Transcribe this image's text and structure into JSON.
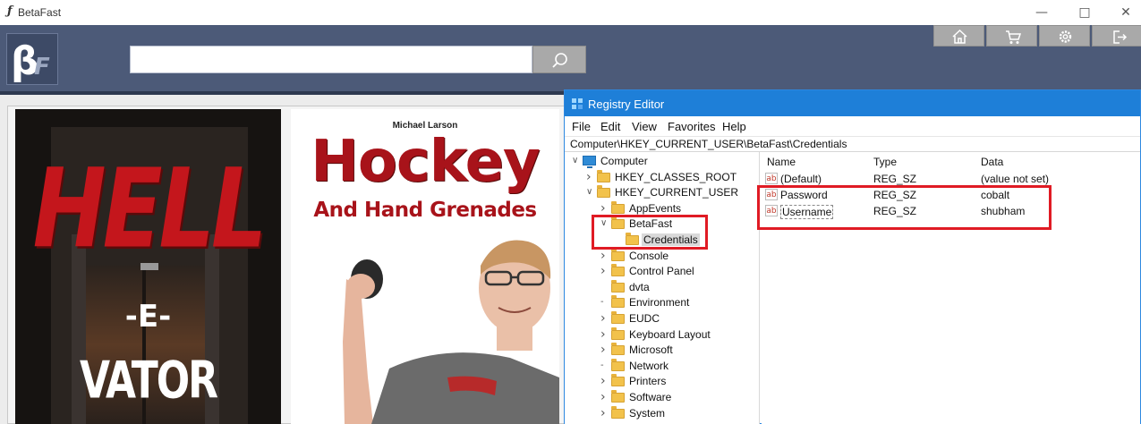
{
  "betafast": {
    "title": "BetaFast",
    "search_placeholder": "",
    "icons": [
      "search-icon",
      "home-icon",
      "cart-icon",
      "gear-icon",
      "logout-icon"
    ],
    "covers": [
      {
        "title_big": "HELL",
        "mid": "-E-",
        "bottom": "VATOR"
      },
      {
        "author": "Michael Larson",
        "title": "Hockey",
        "subtitle": "And Hand Grenades"
      }
    ]
  },
  "registry": {
    "title": "Registry Editor",
    "menu": [
      "File",
      "Edit",
      "View",
      "Favorites",
      "Help"
    ],
    "address": "Computer\\HKEY_CURRENT_USER\\BetaFast\\Credentials",
    "tree": [
      {
        "label": "Computer",
        "indent": 0,
        "arrow": "down",
        "type": "computer"
      },
      {
        "label": "HKEY_CLASSES_ROOT",
        "indent": 1,
        "arrow": "right",
        "type": "folder"
      },
      {
        "label": "HKEY_CURRENT_USER",
        "indent": 1,
        "arrow": "down",
        "type": "folder"
      },
      {
        "label": "AppEvents",
        "indent": 2,
        "arrow": "right",
        "type": "folder"
      },
      {
        "label": "BetaFast",
        "indent": 2,
        "arrow": "down",
        "type": "folder"
      },
      {
        "label": "Credentials",
        "indent": 3,
        "arrow": "",
        "type": "folder",
        "selected": true
      },
      {
        "label": "Console",
        "indent": 2,
        "arrow": "right",
        "type": "folder"
      },
      {
        "label": "Control Panel",
        "indent": 2,
        "arrow": "right",
        "type": "folder"
      },
      {
        "label": "dvta",
        "indent": 2,
        "arrow": "",
        "type": "folder"
      },
      {
        "label": "Environment",
        "indent": 2,
        "arrow": "dash",
        "type": "folder"
      },
      {
        "label": "EUDC",
        "indent": 2,
        "arrow": "right",
        "type": "folder"
      },
      {
        "label": "Keyboard Layout",
        "indent": 2,
        "arrow": "right",
        "type": "folder"
      },
      {
        "label": "Microsoft",
        "indent": 2,
        "arrow": "right",
        "type": "folder"
      },
      {
        "label": "Network",
        "indent": 2,
        "arrow": "dash",
        "type": "folder"
      },
      {
        "label": "Printers",
        "indent": 2,
        "arrow": "right",
        "type": "folder"
      },
      {
        "label": "Software",
        "indent": 2,
        "arrow": "right",
        "type": "folder"
      },
      {
        "label": "System",
        "indent": 2,
        "arrow": "right",
        "type": "folder"
      }
    ],
    "columns": {
      "name": "Name",
      "type": "Type",
      "data": "Data"
    },
    "values": [
      {
        "name": "(Default)",
        "type": "REG_SZ",
        "data": "(value not set)"
      },
      {
        "name": "Password",
        "type": "REG_SZ",
        "data": "cobalt"
      },
      {
        "name": "Username",
        "type": "REG_SZ",
        "data": "shubham"
      }
    ]
  }
}
